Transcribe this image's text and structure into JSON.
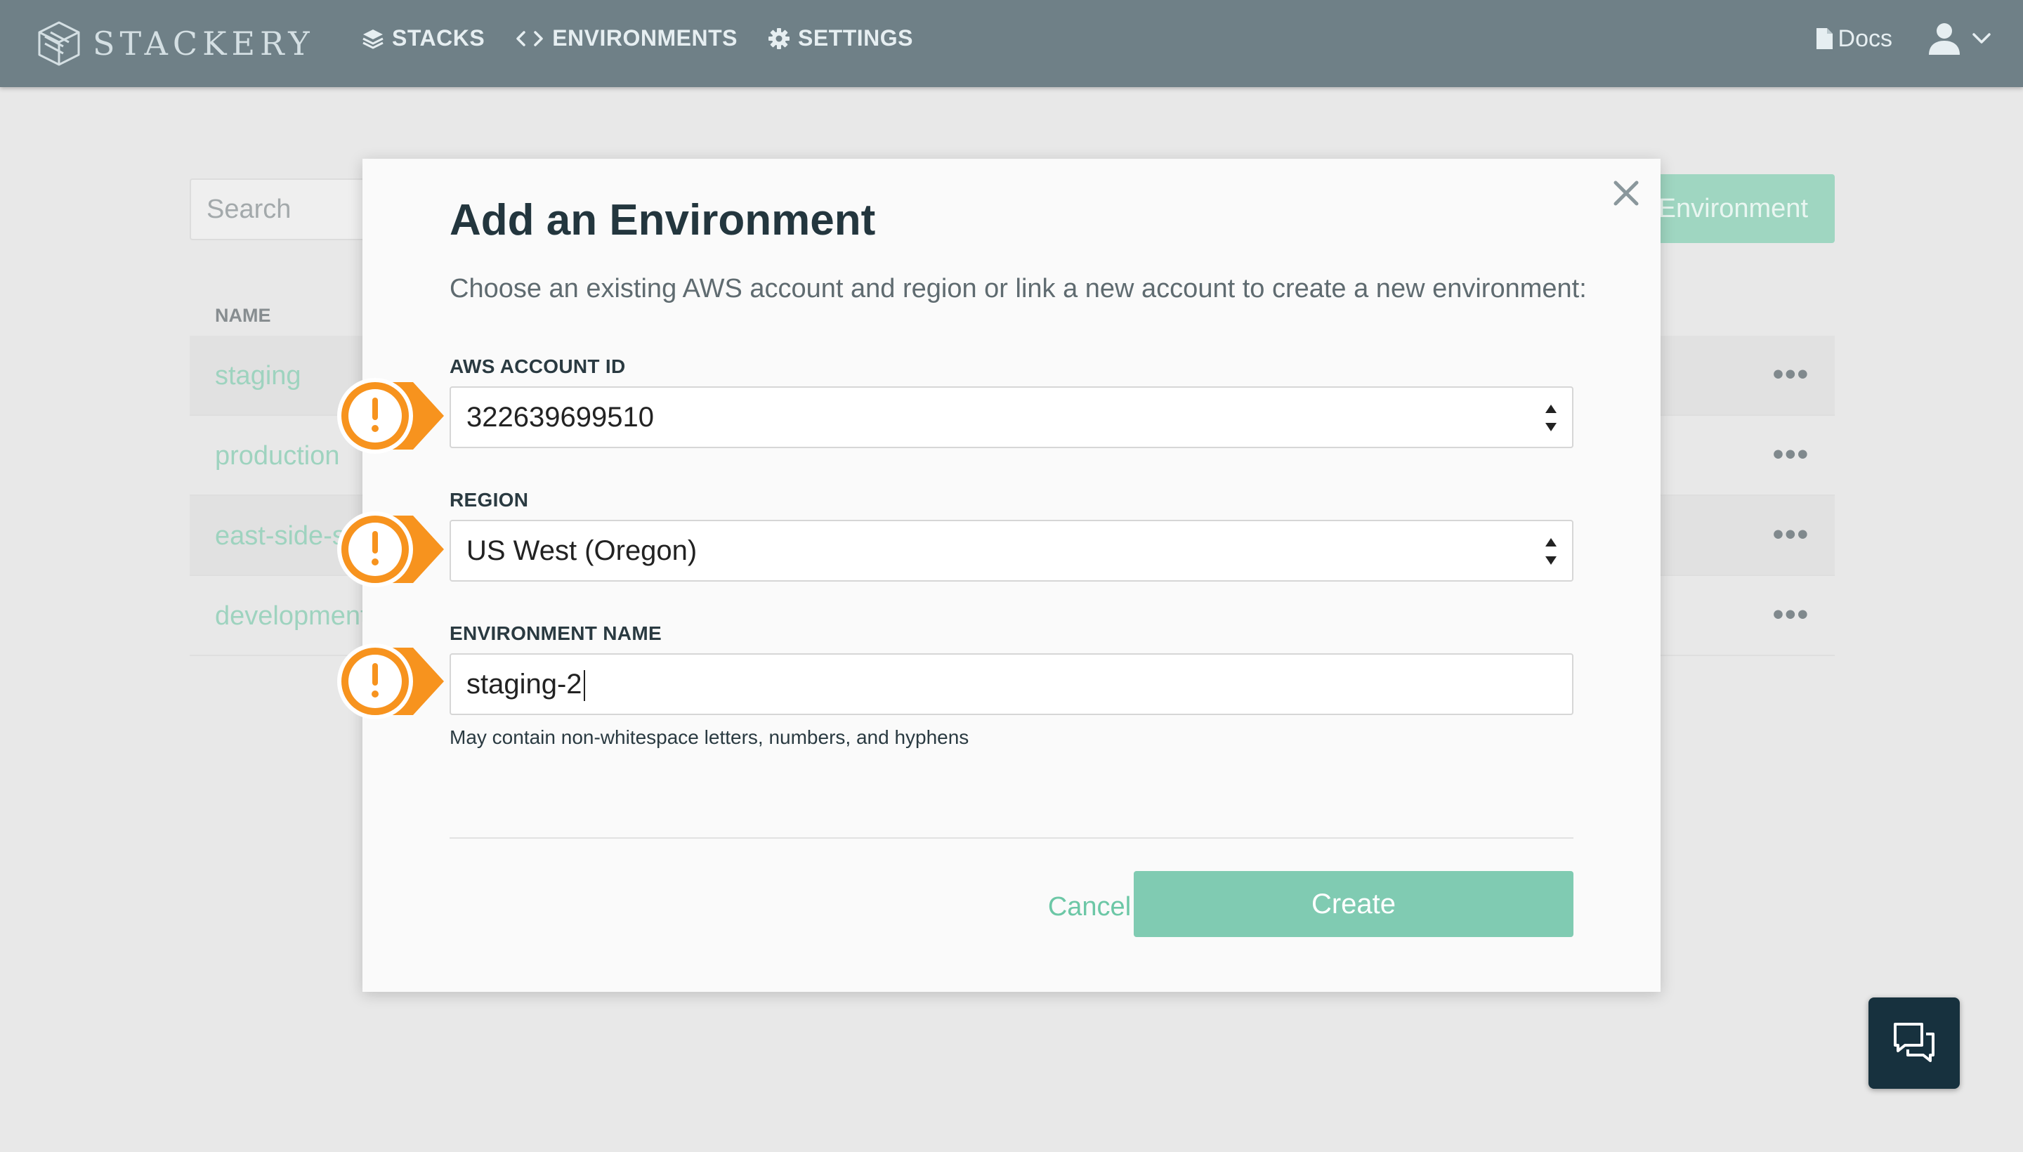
{
  "header": {
    "brand": "STACKERY",
    "nav": [
      {
        "label": "STACKS",
        "icon": "layers-icon"
      },
      {
        "label": "ENVIRONMENTS",
        "icon": "code-brackets-icon"
      },
      {
        "label": "SETTINGS",
        "icon": "gear-icon"
      }
    ],
    "docs_label": "Docs",
    "docs_icon": "document-icon",
    "user_icon": "user-icon"
  },
  "background": {
    "search_placeholder": "Search",
    "add_button_label": "Environment",
    "column_header": "NAME",
    "rows": [
      {
        "name": "staging"
      },
      {
        "name": "production"
      },
      {
        "name": "east-side-s"
      },
      {
        "name": "development"
      }
    ],
    "row_menu_glyph": "•••"
  },
  "modal": {
    "title": "Add an Environment",
    "description": "Choose an existing AWS account and region or link a new account to create a new environment:",
    "account": {
      "label": "AWS ACCOUNT ID",
      "value": "322639699510"
    },
    "region": {
      "label": "REGION",
      "value": "US West (Oregon)"
    },
    "env_name": {
      "label": "ENVIRONMENT NAME",
      "value": "staging-2"
    },
    "hint": "May contain non-whitespace letters, numbers, and hyphens",
    "cancel_label": "Cancel",
    "create_label": "Create"
  },
  "colors": {
    "topbar": "#6f8087",
    "accent_green": "#80cbb2",
    "warning_orange": "#f7931e",
    "chat_bg": "#17313e"
  }
}
